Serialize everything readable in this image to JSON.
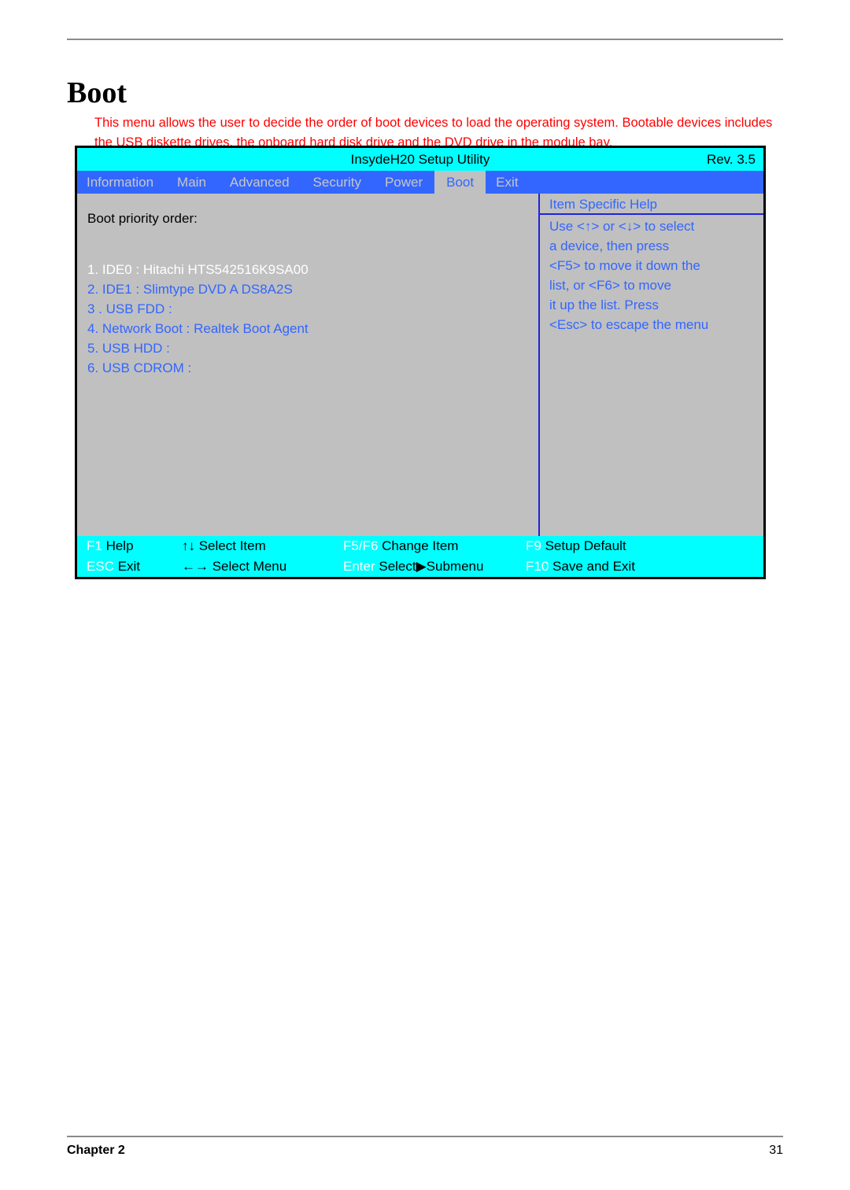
{
  "document": {
    "title": "Boot",
    "intro": "This menu allows the user to decide the order of boot devices to load the operating system. Bootable devices includes the USB diskette drives, the onboard hard disk drive and the DVD drive in the module bay.",
    "footer_left": "Chapter 2",
    "footer_right": "31"
  },
  "bios": {
    "titlebar": {
      "utility_name": "InsydeH20 Setup Utility",
      "revision": "Rev. 3.5"
    },
    "menu_tabs": [
      {
        "label": "Information",
        "active": false
      },
      {
        "label": "Main",
        "active": false
      },
      {
        "label": "Advanced",
        "active": false
      },
      {
        "label": "Security",
        "active": false
      },
      {
        "label": "Power",
        "active": false
      },
      {
        "label": "Boot",
        "active": true
      },
      {
        "label": "Exit",
        "active": false
      }
    ],
    "left_pane": {
      "heading": "Boot priority order:",
      "items": [
        {
          "label": "1. IDE0 : Hitachi HTS542516K9SA00",
          "selected": true
        },
        {
          "label": "2. IDE1 : Slimtype DVD A DS8A2S",
          "selected": false
        },
        {
          "label": "3 . USB FDD :",
          "selected": false
        },
        {
          "label": "4. Network Boot : Realtek Boot Agent",
          "selected": false
        },
        {
          "label": "5. USB HDD :",
          "selected": false
        },
        {
          "label": "6. USB CDROM :",
          "selected": false
        }
      ]
    },
    "help_pane": {
      "title": "Item Specific Help",
      "lines": [
        "Use <↑> or <↓> to select",
        "a device, then press",
        "<F5> to move it down the",
        "list, or <F6> to move",
        "it up the list. Press",
        "<Esc> to escape the menu"
      ]
    },
    "key_bar": {
      "row1": [
        {
          "key": "F1",
          "desc": " Help"
        },
        {
          "key": "↑↓",
          "desc": " Select Item",
          "key_black": true
        },
        {
          "key": "F5/F6",
          "desc": " Change Item"
        },
        {
          "key": "F9",
          "desc": " Setup Default"
        }
      ],
      "row2": [
        {
          "key": "ESC",
          "desc": " Exit"
        },
        {
          "key": "←→",
          "desc": " Select Menu",
          "key_black": true
        },
        {
          "key": "Enter",
          "desc": " Select▶Submenu"
        },
        {
          "key": "F10",
          "desc": " Save and Exit"
        }
      ]
    },
    "colors": {
      "titlebar_bg": "#00ffff",
      "menubar_bg": "#3366ff",
      "panel_bg": "#c0c0c0",
      "accent_blue": "#3366ff",
      "divider_blue": "#2222dd",
      "selected_text": "#ffffff",
      "intro_red": "#ff0000"
    }
  }
}
